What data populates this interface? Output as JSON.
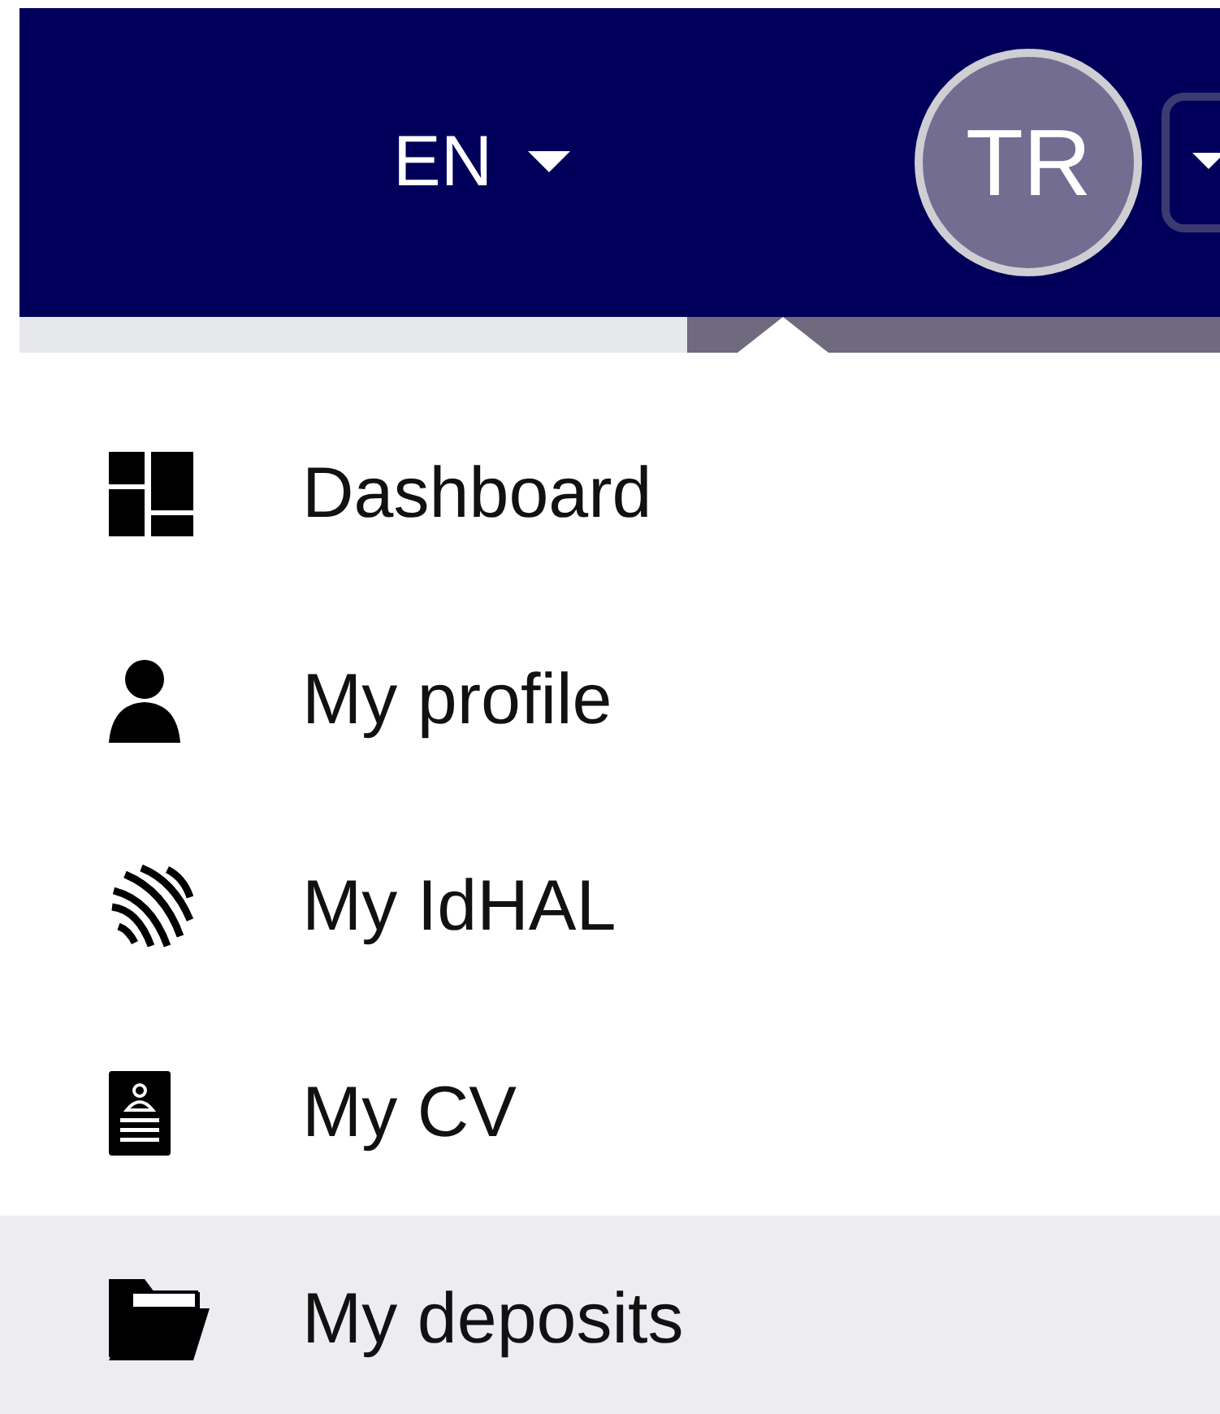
{
  "header": {
    "language": "EN",
    "avatar": "TR"
  },
  "menu": [
    {
      "kind": "dashboard",
      "label": "Dashboard",
      "selected": false
    },
    {
      "kind": "profile",
      "label": "My profile",
      "selected": false
    },
    {
      "kind": "idhal",
      "label": "My IdHAL",
      "selected": false
    },
    {
      "kind": "cv",
      "label": "My CV",
      "selected": false
    },
    {
      "kind": "deposits",
      "label": "My deposits",
      "selected": true
    }
  ]
}
